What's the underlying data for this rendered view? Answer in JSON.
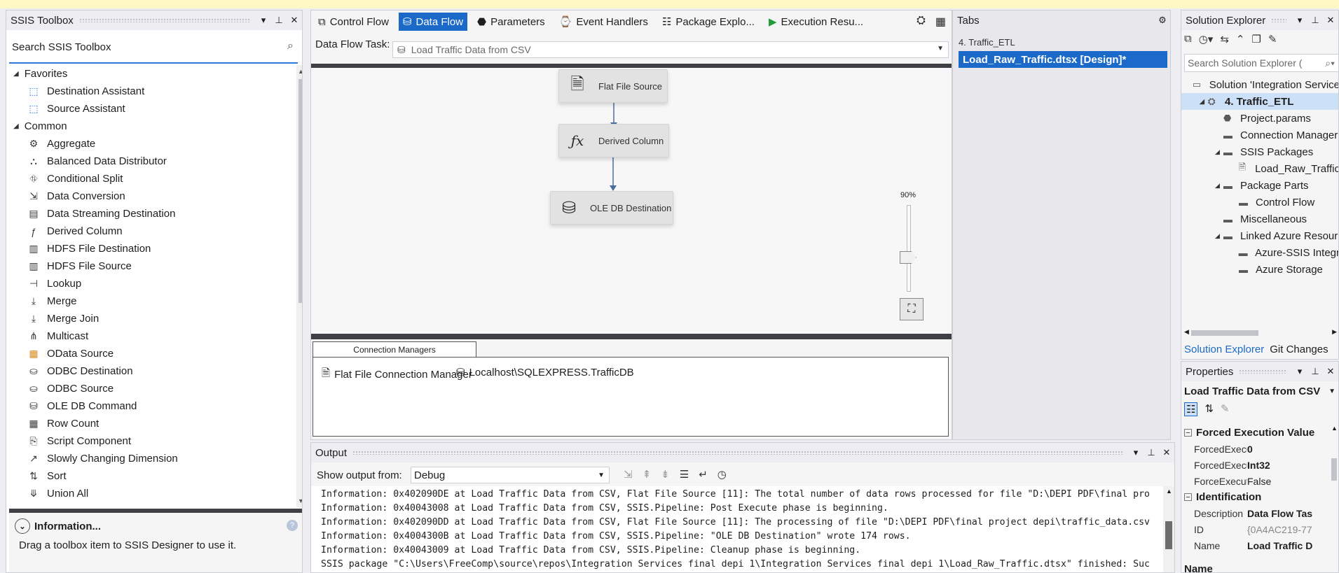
{
  "toolbox": {
    "title": "SSIS Toolbox",
    "search_placeholder": "Search SSIS Toolbox",
    "groups": [
      {
        "label": "Favorites",
        "items": [
          {
            "label": "Destination Assistant",
            "icon": "destination-assistant-icon"
          },
          {
            "label": "Source Assistant",
            "icon": "source-assistant-icon"
          }
        ]
      },
      {
        "label": "Common",
        "items": [
          {
            "label": "Aggregate",
            "icon": "aggregate-icon"
          },
          {
            "label": "Balanced Data Distributor",
            "icon": "balanced-distributor-icon"
          },
          {
            "label": "Conditional Split",
            "icon": "conditional-split-icon"
          },
          {
            "label": "Data Conversion",
            "icon": "data-conversion-icon"
          },
          {
            "label": "Data Streaming Destination",
            "icon": "data-streaming-icon"
          },
          {
            "label": "Derived Column",
            "icon": "derived-column-icon"
          },
          {
            "label": "HDFS File Destination",
            "icon": "hdfs-destination-icon"
          },
          {
            "label": "HDFS File Source",
            "icon": "hdfs-source-icon"
          },
          {
            "label": "Lookup",
            "icon": "lookup-icon"
          },
          {
            "label": "Merge",
            "icon": "merge-icon"
          },
          {
            "label": "Merge Join",
            "icon": "merge-join-icon"
          },
          {
            "label": "Multicast",
            "icon": "multicast-icon"
          },
          {
            "label": "OData Source",
            "icon": "odata-source-icon"
          },
          {
            "label": "ODBC Destination",
            "icon": "odbc-destination-icon"
          },
          {
            "label": "ODBC Source",
            "icon": "odbc-source-icon"
          },
          {
            "label": "OLE DB Command",
            "icon": "oledb-command-icon"
          },
          {
            "label": "Row Count",
            "icon": "row-count-icon"
          },
          {
            "label": "Script Component",
            "icon": "script-component-icon"
          },
          {
            "label": "Slowly Changing Dimension",
            "icon": "scd-icon"
          },
          {
            "label": "Sort",
            "icon": "sort-icon"
          },
          {
            "label": "Union All",
            "icon": "union-all-icon"
          }
        ]
      }
    ],
    "info": {
      "title": "Information...",
      "body": "Drag a toolbox item to SSIS Designer to use it."
    }
  },
  "designer": {
    "tabs": [
      {
        "label": "Control Flow",
        "icon": "control-flow-icon",
        "active": false
      },
      {
        "label": "Data Flow",
        "icon": "data-flow-icon",
        "active": true
      },
      {
        "label": "Parameters",
        "icon": "parameters-icon",
        "active": false
      },
      {
        "label": "Event Handlers",
        "icon": "event-handlers-icon",
        "active": false
      },
      {
        "label": "Package Explo...",
        "icon": "package-explorer-icon",
        "active": false
      },
      {
        "label": "Execution Resu...",
        "icon": "execution-results-icon",
        "active": false
      }
    ],
    "task_label": "Data Flow Task:",
    "task_value": "Load Traffic Data from CSV",
    "nodes": [
      {
        "label": "Flat File Source",
        "icon": "flat-file-source-icon"
      },
      {
        "label": "Derived Column",
        "icon": "derived-column-icon"
      },
      {
        "label": "OLE DB Destination",
        "icon": "oledb-destination-icon"
      }
    ],
    "zoom": "90%",
    "connection_managers": {
      "tab_label": "Connection Managers",
      "items": [
        {
          "label": "Flat File Connection Manager",
          "icon": "flat-file-connection-icon"
        },
        {
          "label": "Localhost\\SQLEXPRESS.TrafficDB",
          "icon": "oledb-connection-icon"
        }
      ]
    }
  },
  "tabs_panel": {
    "title": "Tabs",
    "group": "4. Traffic_ETL",
    "file": "Load_Raw_Traffic.dtsx [Design]*"
  },
  "solution_explorer": {
    "title": "Solution Explorer",
    "search_placeholder": "Search Solution Explorer (",
    "tree": [
      {
        "label": "Solution 'Integration Service",
        "level": 0,
        "toggle": "",
        "icon": "solution-icon"
      },
      {
        "label": "4. Traffic_ETL",
        "level": 1,
        "toggle": "◢",
        "icon": "project-icon",
        "selected": true
      },
      {
        "label": "Project.params",
        "level": 2,
        "toggle": "",
        "icon": "params-icon"
      },
      {
        "label": "Connection Manager",
        "level": 2,
        "toggle": "",
        "icon": "folder-icon"
      },
      {
        "label": "SSIS Packages",
        "level": 2,
        "toggle": "◢",
        "icon": "folder-icon"
      },
      {
        "label": "Load_Raw_Traffic",
        "level": 3,
        "toggle": "",
        "icon": "package-icon"
      },
      {
        "label": "Package Parts",
        "level": 2,
        "toggle": "◢",
        "icon": "folder-icon"
      },
      {
        "label": "Control Flow",
        "level": 3,
        "toggle": "",
        "icon": "folder-icon"
      },
      {
        "label": "Miscellaneous",
        "level": 2,
        "toggle": "",
        "icon": "folder-icon"
      },
      {
        "label": "Linked Azure Resour",
        "level": 2,
        "toggle": "◢",
        "icon": "folder-icon"
      },
      {
        "label": "Azure-SSIS Integr",
        "level": 3,
        "toggle": "",
        "icon": "folder-icon"
      },
      {
        "label": "Azure Storage",
        "level": 3,
        "toggle": "",
        "icon": "folder-icon"
      }
    ],
    "bottom_tabs": [
      "Solution Explorer",
      "Git Changes"
    ]
  },
  "properties": {
    "title": "Properties",
    "object": "Load Traffic Data from CSV",
    "categories": [
      {
        "label": "Forced Execution Value",
        "rows": [
          {
            "key": "ForcedExecu",
            "value": "0",
            "style": "bold"
          },
          {
            "key": "ForcedExecu",
            "value": "Int32",
            "style": "bold"
          },
          {
            "key": "ForceExecuti",
            "value": "False",
            "style": "norm"
          }
        ]
      },
      {
        "label": "Identification",
        "rows": [
          {
            "key": "Description",
            "value": "Data Flow Tas",
            "style": "bold"
          },
          {
            "key": "ID",
            "value": "{0A4AC219-77",
            "style": "dim"
          },
          {
            "key": "Name",
            "value": "Load Traffic D",
            "style": "bold"
          }
        ]
      }
    ],
    "description_title": "Name"
  },
  "output": {
    "title": "Output",
    "show_from_label": "Show output from:",
    "show_from_value": "Debug",
    "lines": [
      "Information: 0x402090DE at Load Traffic Data from CSV, Flat File Source [11]: The total number of data rows processed for file \"D:\\DEPI PDF\\final pro",
      "Information: 0x40043008 at Load Traffic Data from CSV, SSIS.Pipeline: Post Execute phase is beginning.",
      "Information: 0x402090DD at Load Traffic Data from CSV, Flat File Source [11]: The processing of file \"D:\\DEPI PDF\\final project depi\\traffic_data.csv",
      "Information: 0x4004300B at Load Traffic Data from CSV, SSIS.Pipeline: \"OLE DB Destination\" wrote 174 rows.",
      "Information: 0x40043009 at Load Traffic Data from CSV, SSIS.Pipeline: Cleanup phase is beginning.",
      "SSIS package \"C:\\Users\\FreeComp\\source\\repos\\Integration Services final depi 1\\Integration Services final depi 1\\Load_Raw_Traffic.dtsx\" finished: Suc"
    ]
  }
}
